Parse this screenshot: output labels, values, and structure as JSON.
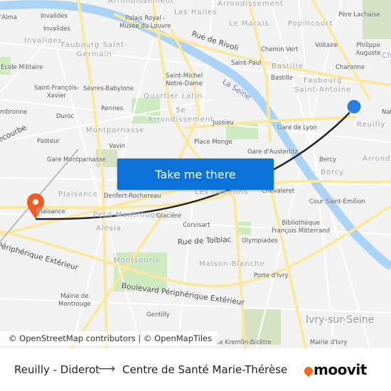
{
  "map": {
    "labels": [
      "Invalides",
      "Invalides",
      "Invalides",
      "Faubourg Saint-\nGermain",
      "École Militaire",
      "Saint-François-\nXavier",
      "Sèvres-Babylone",
      "Rennes",
      "Quartier Latin",
      "5e\nArrondissement",
      "Duroc",
      "Montparnasse",
      "Pasteur",
      "Vavin",
      "Gare Montparnasse",
      "Palais Royal -\nMusée du Louvre",
      "Arrondissement",
      "Les Halles",
      "Arrondissement",
      "Le Marais",
      "Popincourt",
      "Père Lachaise",
      "Rue de Rivoli",
      "Chemin Vert",
      "Voltaire",
      "Philippe Auguste",
      "Saint-Paul",
      "Bastille",
      "Bastille",
      "Charonne",
      "Faubourg\nSaint-Antoine",
      "Saint-Michel\nNotre-Dame",
      "La Seine",
      "Jussieu",
      "Gare de Lyon",
      "Reuilly",
      "Place Monge",
      "Gare d'Austerlitz",
      "Bercy",
      "Bercy",
      "Arrondi",
      "Plaisance",
      "Denfert-Rochereau",
      "Les Gobelins",
      "Chevaleret",
      "Cour Saint-Émilion",
      "Plaisance",
      "Petit-Montrouge",
      "Glacière",
      "Alésia",
      "Corvisart",
      "Bibliothèque\nFrançois Mitterrand",
      "Rue de Tolbiac",
      "Olympiades",
      "Montsouris",
      "Maison-Blanche",
      "Porte d'Ivry",
      "Périphérique Extérieur",
      "Boulevard Périphérique Extérieur",
      "Mairie de\nMontrouge",
      "Gentilly",
      "Ivry-sur-Seine",
      "Mairie d'Ivry",
      "Le Kremlin-Bicêtre",
      "'Alma",
      "mbronne",
      "ecourbe",
      "Nat",
      "Ch"
    ],
    "cta_label": "Take me there",
    "attribution": "© OpenStreetMap contributors | © OpenMapTiles",
    "route_color": "#222222",
    "origin_marker_color": "#2a7de1",
    "destination_marker_color": "#f05a22"
  },
  "footer": {
    "from": "Reuilly - Diderot",
    "arrow": "⟶",
    "to": "Centre de Santé Marie-Thérèse",
    "logo": "moovit",
    "logo_color": "#f26b1d"
  }
}
